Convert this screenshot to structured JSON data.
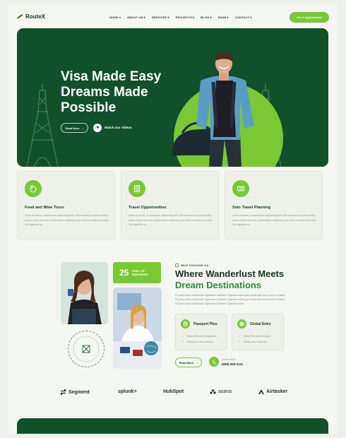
{
  "brand": {
    "name": "RouteX",
    "logo_icon": "route-leaf-icon"
  },
  "nav": {
    "items": [
      {
        "label": "HOME"
      },
      {
        "label": "ABOUT US"
      },
      {
        "label": "SERVICES"
      },
      {
        "label": "PROJECTS"
      },
      {
        "label": "BLOG"
      },
      {
        "label": "PAGE"
      },
      {
        "label": "CONTACT"
      }
    ],
    "cta": "Get A Appointment"
  },
  "hero": {
    "title_lines": [
      "Visa Made Easy",
      "Dreams Made",
      "Possible"
    ],
    "read_more": "Read More",
    "watch": "Watch Our Videos"
  },
  "features": [
    {
      "title": "Food and Wine Tours",
      "icon": "food-icon",
      "desc": "Dolor sit amet, consectetur adipiscing elit. Sed et amet mi purus Dolor ipsum dolor sit amet, consectetur adipiscing elit. Sed et amet mi purus. Dui egestas et"
    },
    {
      "title": "Travel Opportunities",
      "icon": "passport-icon",
      "desc": "Dolor sit amet, consectetur adipiscing elit. Sed et amet mi purus Dolor ipsum dolor sit amet, consectetur adipiscing elit. Sed et amet mi purus. Dui egestas et"
    },
    {
      "title": "Solo Travel Planning",
      "icon": "ticket-icon",
      "desc": "Dolor sit amet, consectetur adipiscing elit. Sed et amet mi purus Dolor ipsum dolor sit amet, consectetur adipiscing elit. Sed et amet mi purus. Dui egestas et"
    }
  ],
  "about": {
    "years": "25",
    "years_label": "Years Of experience",
    "badge_text": "Travel Expert Approved",
    "eyebrow": "WHY CHOOSE US",
    "title_line1": "Where Wanderlust Meets",
    "title_line2": "Dream Destinations",
    "desc": "Et purus duis sollicitudin dignissim habitant. Egestas nulla quis venenatis cras sed eu massa Et purus duis sollicitudin dignissim habitant. Egestas nulla quis venenatis cras sed eu massa Et purus duis sollicitudin dignissim habitant. Egestas nulla",
    "cards": [
      {
        "title": "Passport Plus",
        "icon": "passport-icon",
        "items": [
          "Beyond Border Immigration",
          "Worldwide Visa Advisors"
        ]
      },
      {
        "title": "Global Entry",
        "icon": "globe-icon",
        "items": [
          "Global Pro Visa Services",
          "Infinity Visa Solutions"
        ]
      }
    ],
    "read_more": "Read More",
    "help_label": "Need Help?",
    "help_phone": "(808) 555-0111"
  },
  "partners": [
    "Segment",
    "splunk>",
    "HubSpot",
    "asana",
    "Airtasker"
  ],
  "colors": {
    "dark_green": "#10512b",
    "lime": "#7ac832",
    "page_bg": "#f4f6f1"
  }
}
